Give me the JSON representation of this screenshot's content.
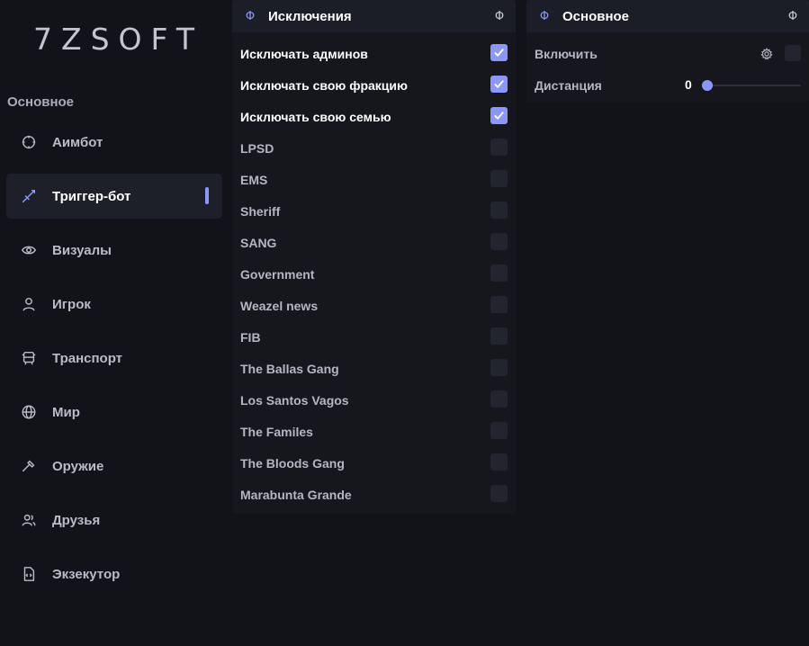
{
  "app": {
    "logo": "7ZSOFT"
  },
  "colors": {
    "accent": "#8b97ff",
    "background": "#111318",
    "panel": "#15171d"
  },
  "sidebar": {
    "section_title": "Основное",
    "items": [
      {
        "label": "Аимбот",
        "icon": "crosshair-icon",
        "active": false
      },
      {
        "label": "Триггер-бот",
        "icon": "sword-icon",
        "active": true
      },
      {
        "label": "Визуалы",
        "icon": "eye-icon",
        "active": false
      },
      {
        "label": "Игрок",
        "icon": "user-icon",
        "active": false
      },
      {
        "label": "Транспорт",
        "icon": "bus-icon",
        "active": false
      },
      {
        "label": "Мир",
        "icon": "globe-icon",
        "active": false
      },
      {
        "label": "Оружие",
        "icon": "hammer-icon",
        "active": false
      },
      {
        "label": "Друзья",
        "icon": "users-icon",
        "active": false
      },
      {
        "label": "Экзекутор",
        "icon": "code-file-icon",
        "active": false
      }
    ]
  },
  "exclusions_panel": {
    "title": "Исключения",
    "icon_left": "Φ",
    "icon_right": "Φ",
    "items": [
      {
        "label": "Исключать админов",
        "checked": true
      },
      {
        "label": "Исключать свою фракцию",
        "checked": true
      },
      {
        "label": "Исключать свою семью",
        "checked": true
      },
      {
        "label": "LPSD",
        "checked": false
      },
      {
        "label": "EMS",
        "checked": false
      },
      {
        "label": "Sheriff",
        "checked": false
      },
      {
        "label": "SANG",
        "checked": false
      },
      {
        "label": "Government",
        "checked": false
      },
      {
        "label": "Weazel news",
        "checked": false
      },
      {
        "label": "FIB",
        "checked": false
      },
      {
        "label": "The Ballas Gang",
        "checked": false
      },
      {
        "label": "Los Santos Vagos",
        "checked": false
      },
      {
        "label": "The Familes",
        "checked": false
      },
      {
        "label": "The Bloods Gang",
        "checked": false
      },
      {
        "label": "Marabunta Grande",
        "checked": false
      }
    ]
  },
  "main_panel": {
    "title": "Основное",
    "icon_left": "Φ",
    "icon_right": "Φ",
    "enable": {
      "label": "Включить",
      "checked": false
    },
    "distance": {
      "label": "Дистанция",
      "value": "0",
      "fraction": 0.0
    }
  }
}
